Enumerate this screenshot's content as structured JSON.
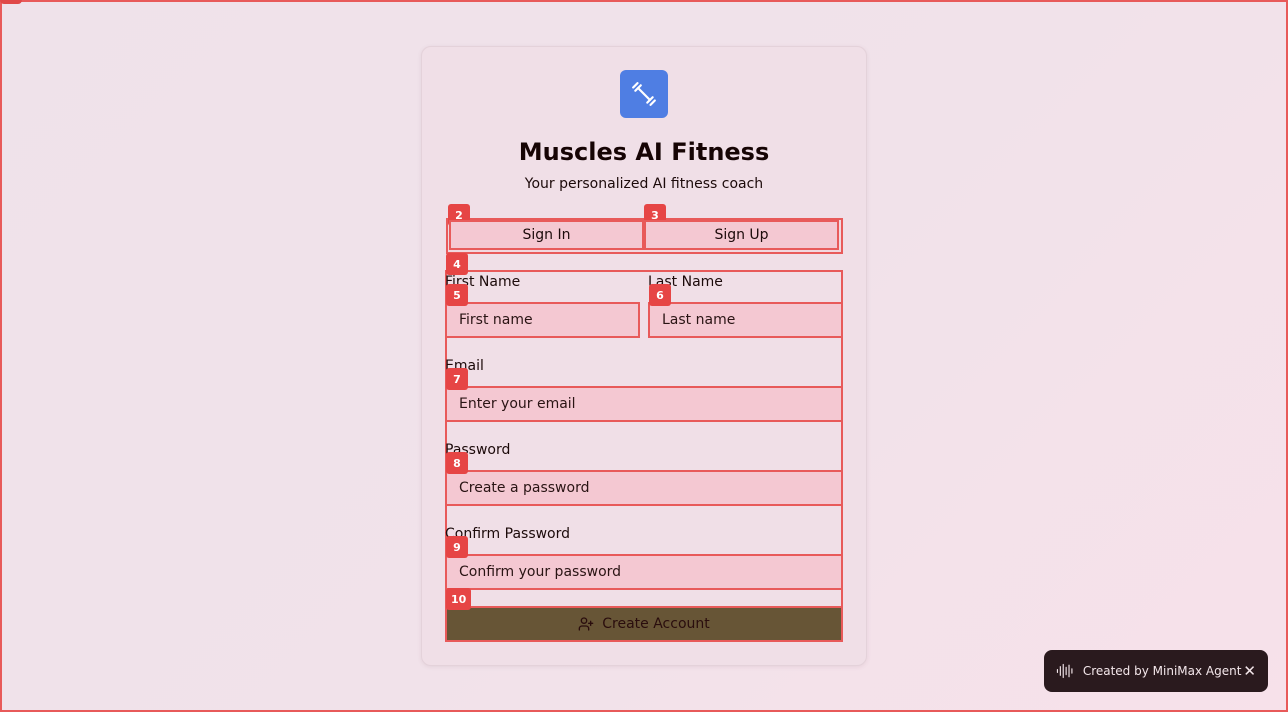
{
  "app": {
    "title": "Muscles AI Fitness",
    "subtitle": "Your personalized AI fitness coach",
    "logo_icon": "dumbbell-icon",
    "accent_color": "#4f7ee3"
  },
  "tabs": [
    {
      "label": "Sign In",
      "badge": "2"
    },
    {
      "label": "Sign Up",
      "badge": "3"
    }
  ],
  "form": {
    "badge": "4",
    "first_name": {
      "label": "First Name",
      "placeholder": "First name",
      "badge": "5"
    },
    "last_name": {
      "label": "Last Name",
      "placeholder": "Last name",
      "badge": "6"
    },
    "email": {
      "label": "Email",
      "placeholder": "Enter your email",
      "badge": "7"
    },
    "password": {
      "label": "Password",
      "placeholder": "Create a password",
      "badge": "8"
    },
    "confirm_password": {
      "label": "Confirm Password",
      "placeholder": "Confirm your password",
      "badge": "9"
    },
    "submit": {
      "label": "Create Account",
      "icon": "user-plus-icon",
      "badge": "10",
      "color": "#675536"
    }
  },
  "toast": {
    "text": "Created by MiniMax Agent",
    "icon": "waveform-icon",
    "close_icon": "close-icon"
  }
}
